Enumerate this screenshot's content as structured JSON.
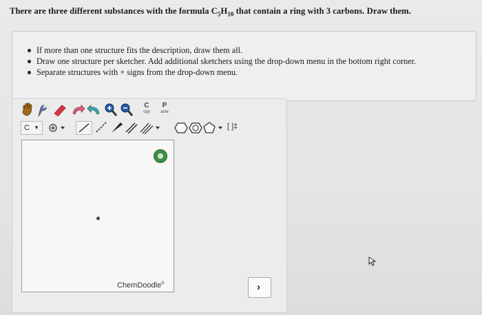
{
  "question": {
    "part1": "There are three different substances with the formula C",
    "sub1": "5",
    "part2": "H",
    "sub2": "10",
    "part3": " that contain a ring with 3 carbons. Draw them."
  },
  "instructions": [
    "If more than one structure fits the description, draw them all.",
    "Draw one structure per sketcher. Add additional sketchers using the drop-down menu in the bottom right corner.",
    "Separate structures with + signs from the drop-down menu."
  ],
  "toolbar": {
    "copy_top": "C",
    "copy_bottom": "opy",
    "paste_top": "P",
    "paste_bottom": "aste",
    "element_label": "C",
    "charge_label": "[ ]‡"
  },
  "sketcher": {
    "brand": "ChemDoodle",
    "brand_mark": "®"
  },
  "dropdown": {
    "chevron": "›"
  }
}
